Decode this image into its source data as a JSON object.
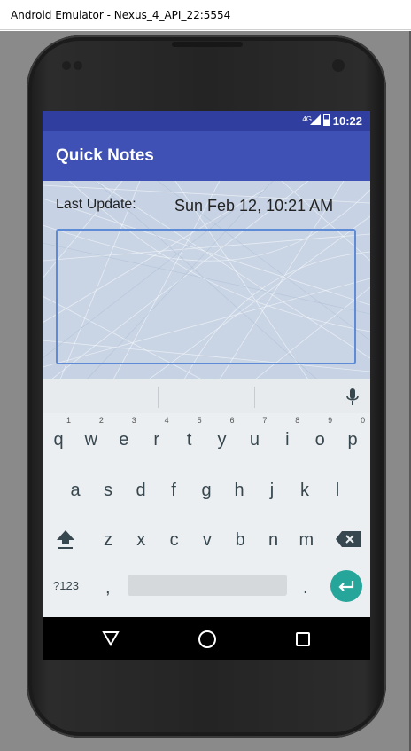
{
  "window": {
    "title": "Android Emulator - Nexus_4_API_22:5554"
  },
  "status_bar": {
    "network": "4G",
    "time": "10:22"
  },
  "app_bar": {
    "title": "Quick Notes"
  },
  "content": {
    "last_update_label": "Last Update:",
    "last_update_value": "Sun Feb 12, 10:21 AM",
    "note_text": ""
  },
  "keyboard": {
    "row1": [
      {
        "key": "q",
        "num": "1"
      },
      {
        "key": "w",
        "num": "2"
      },
      {
        "key": "e",
        "num": "3"
      },
      {
        "key": "r",
        "num": "4"
      },
      {
        "key": "t",
        "num": "5"
      },
      {
        "key": "y",
        "num": "6"
      },
      {
        "key": "u",
        "num": "7"
      },
      {
        "key": "i",
        "num": "8"
      },
      {
        "key": "o",
        "num": "9"
      },
      {
        "key": "p",
        "num": "0"
      }
    ],
    "row2": [
      "a",
      "s",
      "d",
      "f",
      "g",
      "h",
      "j",
      "k",
      "l"
    ],
    "row3": [
      "z",
      "x",
      "c",
      "v",
      "b",
      "n",
      "m"
    ],
    "symbols_key": "?123",
    "comma_key": ",",
    "period_key": ".",
    "enter_color": "#26a69a"
  },
  "colors": {
    "status_bar": "#303f9f",
    "app_bar": "#3f51b5",
    "note_border": "#5d8bd6"
  }
}
